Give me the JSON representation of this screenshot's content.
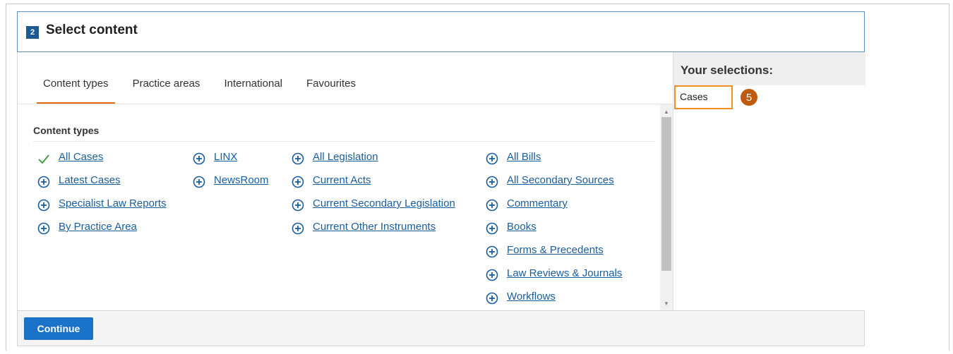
{
  "header": {
    "step_number": "2",
    "title": "Select content"
  },
  "tabs": [
    {
      "label": "Content types",
      "active": true
    },
    {
      "label": "Practice areas",
      "active": false
    },
    {
      "label": "International",
      "active": false
    },
    {
      "label": "Favourites",
      "active": false
    }
  ],
  "section": {
    "title": "Content types"
  },
  "columns": [
    [
      {
        "label": "All Cases",
        "icon": "check-icon"
      },
      {
        "label": "Latest Cases",
        "icon": "plus-circle-icon"
      },
      {
        "label": "Specialist Law Reports",
        "icon": "plus-circle-icon"
      },
      {
        "label": "By Practice Area",
        "icon": "plus-circle-icon"
      }
    ],
    [
      {
        "label": "LINX",
        "icon": "plus-circle-icon"
      },
      {
        "label": "NewsRoom",
        "icon": "plus-circle-icon"
      }
    ],
    [
      {
        "label": "All Legislation",
        "icon": "plus-circle-icon"
      },
      {
        "label": "Current Acts",
        "icon": "plus-circle-icon"
      },
      {
        "label": "Current Secondary Legislation",
        "icon": "plus-circle-icon"
      },
      {
        "label": "Current Other Instruments",
        "icon": "plus-circle-icon"
      }
    ],
    [
      {
        "label": "All Bills",
        "icon": "plus-circle-icon"
      },
      {
        "label": "All Secondary Sources",
        "icon": "plus-circle-icon"
      },
      {
        "label": "Commentary",
        "icon": "plus-circle-icon"
      },
      {
        "label": "Books ",
        "icon": "plus-circle-icon"
      },
      {
        "label": "Forms & Precedents",
        "icon": "plus-circle-icon"
      },
      {
        "label": "Law Reviews & Journals",
        "icon": "plus-circle-icon"
      },
      {
        "label": "Workflows",
        "icon": "plus-circle-icon"
      }
    ]
  ],
  "selections": {
    "title": "Your selections:",
    "items": [
      "Cases"
    ],
    "callout_number": "5"
  },
  "footer": {
    "continue_label": "Continue"
  },
  "colors": {
    "accent": "#1a73c8",
    "link": "#1a5d9c",
    "active_tab": "#e06a10",
    "highlight": "#f0901f",
    "callout": "#c05a10",
    "check": "#3a9a3a"
  }
}
